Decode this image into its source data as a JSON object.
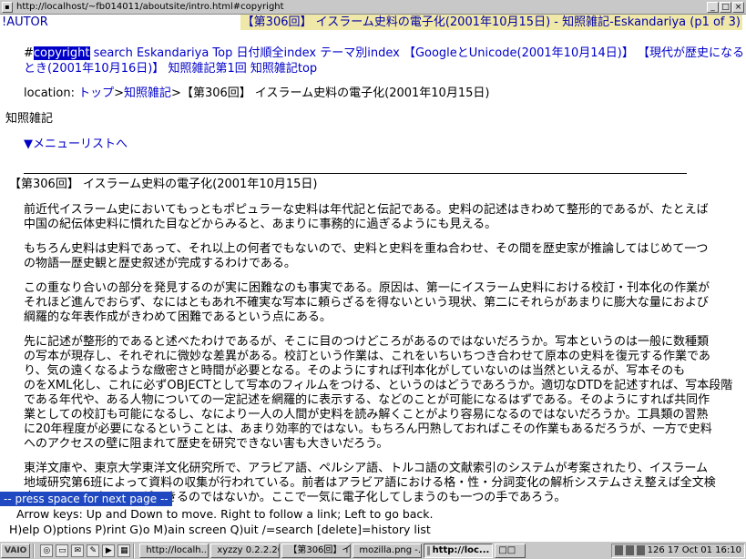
{
  "window": {
    "title": "http://localhost/~fb014011/aboutsite/intro.html#copyright",
    "buttons": [
      "_",
      "□",
      "×"
    ]
  },
  "status": {
    "left": "!AUTOR",
    "right": "【第306回】 イスラーム史料の電子化(2001年10月15日) - 知照雑記-Eskandariya (p1 of 3)"
  },
  "nav": {
    "hash": "#",
    "copyright": "copyright",
    "links_line1": [
      "search",
      "Eskandariya Top",
      "日付順全index",
      "テーマ別index",
      "【GoogleとUnicode(2001年10月14日)】",
      "【現代が歴史になる"
    ],
    "links_line2_part": "とき(2001年10月16日)】",
    "links_line2_more": [
      "知照雑記第1回",
      "知照雑記top"
    ]
  },
  "location": {
    "label": "location:",
    "crumbs": [
      "トップ",
      "知照雑記"
    ],
    "current": "【第306回】 イスラーム史料の電子化(2001年10月15日)"
  },
  "section_title": "知照雑記",
  "menu_link": "▼メニューリストへ",
  "article": {
    "heading": "【第306回】 イスラーム史料の電子化(2001年10月15日)",
    "p1": [
      "前近代イスラーム史においてもっともポピュラーな史料は年代記と伝記である。史料の記述はきわめて整形的であるが、たとえば",
      "中国の紀伝体史料に慣れた目などからみると、あまりに事務的に過ぎるようにも見える。"
    ],
    "p2": [
      "もちろん史料は史料であって、それ以上の何者でもないので、史料と史料を重ね合わせ、その間を歴史家が推論してはじめて一つ",
      "の物語一歴史観と歴史叙述が完成するわけである。"
    ],
    "p3": [
      "この重なり合いの部分を発見するのが実に困難なのも事実である。原因は、第一にイスラーム史料における校訂・刊本化の作業が",
      "それほど進んでおらず、なにはともあれ不確実な写本に頼らざるを得ないという現状、第二にそれらがあまりに膨大な量におよび",
      "綱羅的な年表作成がきわめて困難であるという点にある。"
    ],
    "p4": [
      "先に記述が整形的であると述べたわけであるが、そこに目のつけどころがあるのではないだろうか。写本というのは一般に数種類",
      "の写本が現存し、それぞれに微妙な差異がある。校訂という作業は、これをいちいちつき合わせて原本の史料を復元する作業であ",
      "り、気の遠くなるような緻密さと時間が必要となる。そのようにすれば刊本化がしていないのは当然といえるが、写本そのも",
      "のをXML化し、これに必ずOBJECTとして写本のフィルムをつける、というのはどうであろうか。適切なDTDを記述すれば、写本段階",
      "である年代や、ある人物についての一定記述を網羅的に表示する、などのことが可能になるはずである。そのようにすれば共同作",
      "業としての校訂も可能になるし、なにより一人の人間が史料を読み解くことがより容易になるのではないだろうか。工具類の習熟",
      "に20年程度が必要になるということは、あまり効率的ではない。もちろん円熟しておればこその作業もあるだろうが、一方で史料",
      "へのアクセスの壁に阻まれて歴史を研究できない害も大きいだろう。"
    ],
    "p5": [
      "東洋文庫や、東京大学東洋文化研究所で、アラビア語、ペルシア語、トルコ語の文献索引のシステムが考案されたり、イスラーム",
      "地域研究第6班によって資料の収集が行われている。前者はアラビア語における格・性・分詞変化の解析システムさえ整えば全文検",
      "索システムとすることができるのではないか。ここで一気に電子化してしまうのも一つの手であろう。"
    ]
  },
  "prompt": "-- press space for next page --",
  "help1": "Arrow keys: Up and Down to move.  Right to follow a link; Left to go back.",
  "help2": "H)elp O)ptions P)rint G)o M)ain screen Q)uit /=search [delete]=history list",
  "taskbar": {
    "start": "VAIO",
    "tasks": [
      {
        "label": "http://localh...",
        "active": false
      },
      {
        "label": "xyzzy 0.2.2.20...",
        "active": false
      },
      {
        "label": "【第306回】イ...",
        "active": false
      },
      {
        "label": "mozilla.png -...",
        "active": false
      },
      {
        "label": "http://loc...",
        "active": true
      },
      {
        "label": "□□",
        "active": false
      }
    ],
    "clock": "126 17 Oct 01  16:10"
  }
}
